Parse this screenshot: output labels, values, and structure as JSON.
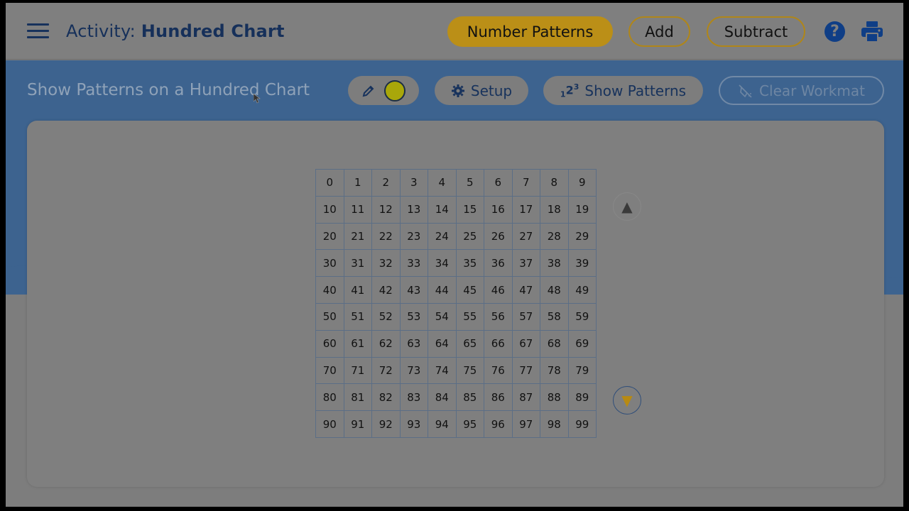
{
  "header": {
    "title_prefix": "Activity: ",
    "title_main": "Hundred Chart",
    "buttons": {
      "number_patterns": "Number Patterns",
      "add": "Add",
      "subtract": "Subtract"
    },
    "help_glyph": "?"
  },
  "toolbar": {
    "subtitle": "Show Patterns on a Hundred Chart",
    "setup_label": "Setup",
    "show_patterns_label": "Show Patterns",
    "show_patterns_icon_digits": [
      "1",
      "2",
      "3"
    ],
    "clear_label": "Clear Workmat"
  },
  "chart": {
    "rows": [
      [
        "0",
        "1",
        "2",
        "3",
        "4",
        "5",
        "6",
        "7",
        "8",
        "9"
      ],
      [
        "10",
        "11",
        "12",
        "13",
        "14",
        "15",
        "16",
        "17",
        "18",
        "19"
      ],
      [
        "20",
        "21",
        "22",
        "23",
        "24",
        "25",
        "26",
        "27",
        "28",
        "29"
      ],
      [
        "30",
        "31",
        "32",
        "33",
        "34",
        "35",
        "36",
        "37",
        "38",
        "39"
      ],
      [
        "40",
        "41",
        "42",
        "43",
        "44",
        "45",
        "46",
        "47",
        "48",
        "49"
      ],
      [
        "50",
        "51",
        "52",
        "53",
        "54",
        "55",
        "56",
        "57",
        "58",
        "59"
      ],
      [
        "60",
        "61",
        "62",
        "63",
        "64",
        "65",
        "66",
        "67",
        "68",
        "69"
      ],
      [
        "70",
        "71",
        "72",
        "73",
        "74",
        "75",
        "76",
        "77",
        "78",
        "79"
      ],
      [
        "80",
        "81",
        "82",
        "83",
        "84",
        "85",
        "86",
        "87",
        "88",
        "89"
      ],
      [
        "90",
        "91",
        "92",
        "93",
        "94",
        "95",
        "96",
        "97",
        "98",
        "99"
      ]
    ]
  },
  "nav": {
    "up_glyph": "▲",
    "down_glyph": "▼"
  },
  "colors": {
    "accent_gold": "#bb8f17",
    "brand_blue": "#3d638f",
    "pen_color": "#a9a70a"
  },
  "icons": [
    "menu-icon",
    "help-icon",
    "print-icon",
    "pencil-icon",
    "gear-icon",
    "numbers-icon",
    "eraser-icon"
  ]
}
